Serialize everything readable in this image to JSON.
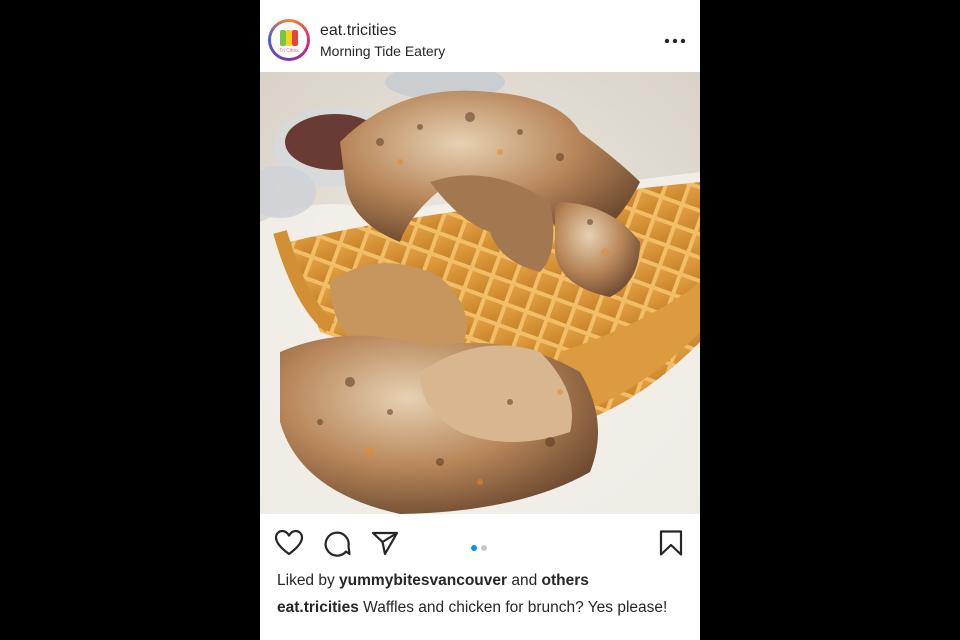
{
  "post": {
    "username": "eat.tricities",
    "location": "Morning Tide Eatery",
    "avatar_text": "Tri Cities",
    "photo_alt": "Fried chicken pieces piled on golden waffles with dipping sauces",
    "carousel": {
      "total": 2,
      "active": 1
    },
    "likes": {
      "prefix": "Liked by",
      "user": "yummybitesvancouver",
      "conj": "and",
      "others": "others"
    },
    "caption": {
      "user": "eat.tricities",
      "text": "Waffles and chicken for brunch? Yes please!"
    }
  },
  "icons": {
    "like": "heart-icon",
    "comment": "comment-icon",
    "share": "send-icon",
    "save": "bookmark-icon",
    "more": "more-options-icon"
  },
  "colors": {
    "active_dot": "#0095f6",
    "inactive_dot": "#c7c7c7",
    "text": "#262626"
  }
}
